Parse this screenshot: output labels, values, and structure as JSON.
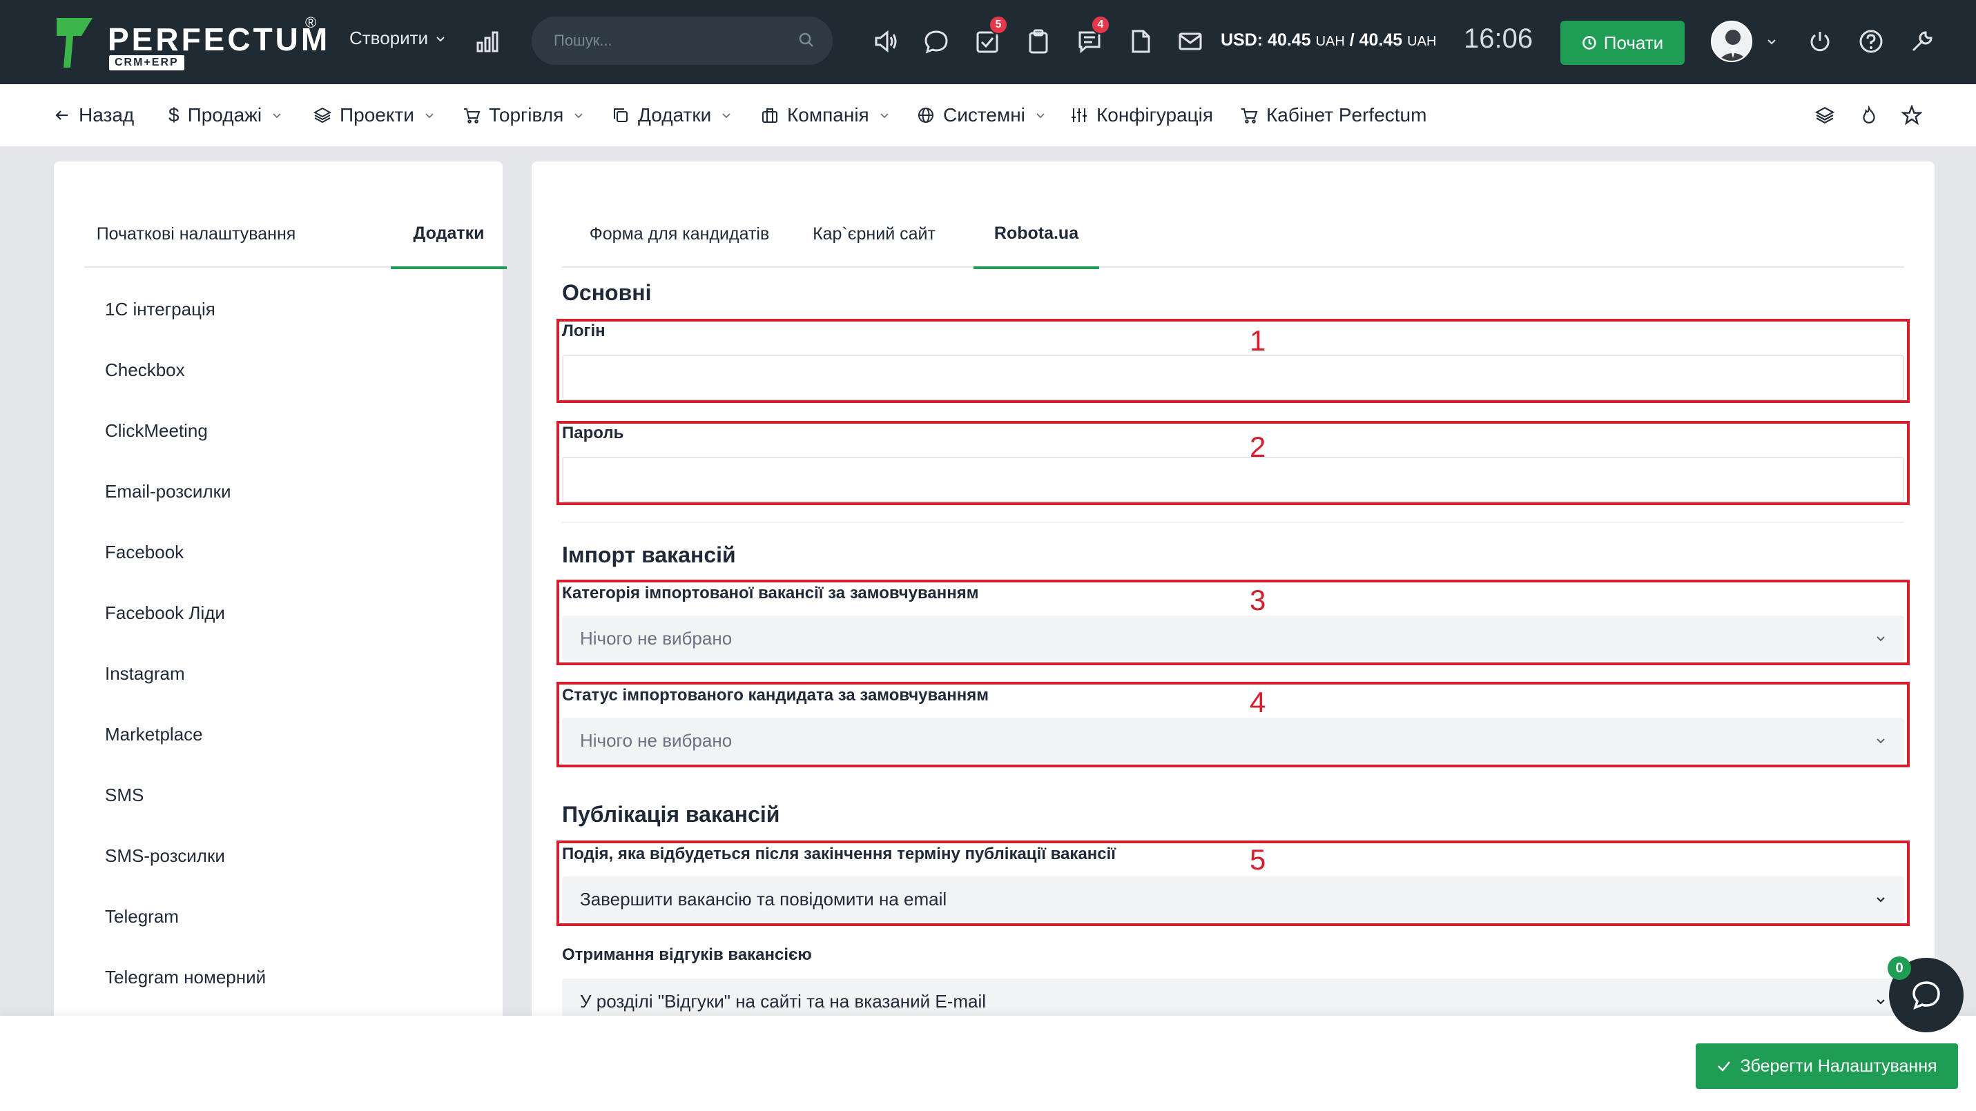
{
  "brand": {
    "name": "PERFECTUM",
    "reg": "®",
    "sub": "CRM+ERP"
  },
  "topbar": {
    "create_label": "Створити",
    "search_placeholder": "Пошук...",
    "tasks_badge": "5",
    "messages_badge": "4",
    "currency_usd": "USD: 40.45",
    "currency_unit1": "UAH",
    "currency_sep": " / 40.45 ",
    "currency_unit2": "UAH",
    "time": "16:06",
    "start_label": "Почати"
  },
  "nav": {
    "back": "Назад",
    "sales": "Продажі",
    "projects": "Проекти",
    "trade": "Торгівля",
    "addons": "Додатки",
    "company": "Компанія",
    "system": "Системні",
    "config": "Конфігурація",
    "cabinet": "Кабінет Perfectum"
  },
  "left": {
    "tabs": [
      "Початкові налаштування",
      "Додатки"
    ],
    "menu": [
      "1С інтеграція",
      "Checkbox",
      "ClickMeeting",
      "Email-розсилки",
      "Facebook",
      "Facebook Ліди",
      "Instagram",
      "Marketplace",
      "SMS",
      "SMS-розсилки",
      "Telegram",
      "Telegram номерний"
    ]
  },
  "right": {
    "tabs": [
      "Форма для кандидатів",
      "Кар`єрний сайт",
      "Robota.ua"
    ],
    "basic_title": "Основні",
    "login_label": "Логін",
    "password_label": "Пароль",
    "import_title": "Імпорт вакансій",
    "category_label": "Категорія імпортованої вакансії за замовчуванням",
    "category_value": "Нічого не вибрано",
    "status_label": "Статус імпортованого кандидата за замовчуванням",
    "status_value": "Нічого не вибрано",
    "publish_title": "Публікація вакансій",
    "event_label": "Подія, яка відбудеться після закінчення терміну публікації вакансії",
    "event_value": "Завершити вакансію та повідомити на email",
    "responses_label": "Отримання відгуків вакансією",
    "responses_value": "У розділі \"Відгуки\" на сайті та на вказаний E-mail"
  },
  "annotations": [
    "1",
    "2",
    "3",
    "4",
    "5"
  ],
  "footer": {
    "save_label": "Зберегти Налаштування"
  },
  "chat": {
    "badge": "0"
  },
  "colors": {
    "accent": "#1f9d55",
    "topbar": "#202a33",
    "annotation": "#d61f2c",
    "badge": "#e5384b"
  }
}
